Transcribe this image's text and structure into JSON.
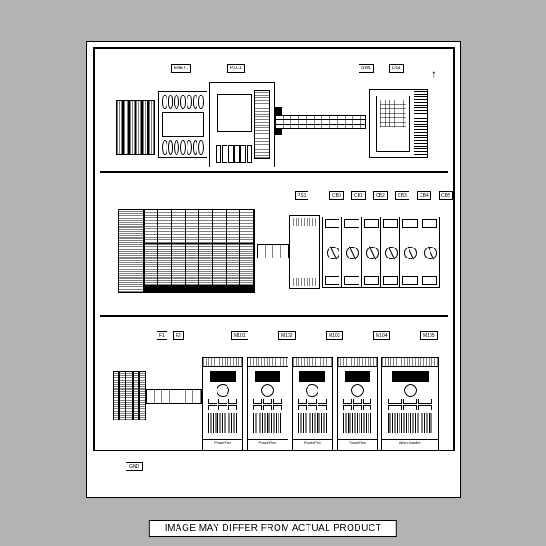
{
  "caption": "IMAGE MAY DIFFER FROM ACTUAL PRODUCT",
  "section1": {
    "tags": {
      "enet": "ENET1",
      "plc": "PLC1",
      "sw": "SW1",
      "ds": "DS1"
    }
  },
  "section2": {
    "tags": {
      "ps": "PS1",
      "cb0": "CB0",
      "cb1": "CB1",
      "cb2": "CB2",
      "cb3": "CB3",
      "cb4": "CB4",
      "cb5": "CB5"
    }
  },
  "section3": {
    "tags": {
      "f1": "F1",
      "f2": "F2",
      "m1": "M101",
      "m2": "M102",
      "m3": "M103",
      "m4": "M104",
      "m5": "M105",
      "gnd": "GND"
    },
    "drive_label": "PowerFlex",
    "brand": "Allen-Bradley"
  }
}
